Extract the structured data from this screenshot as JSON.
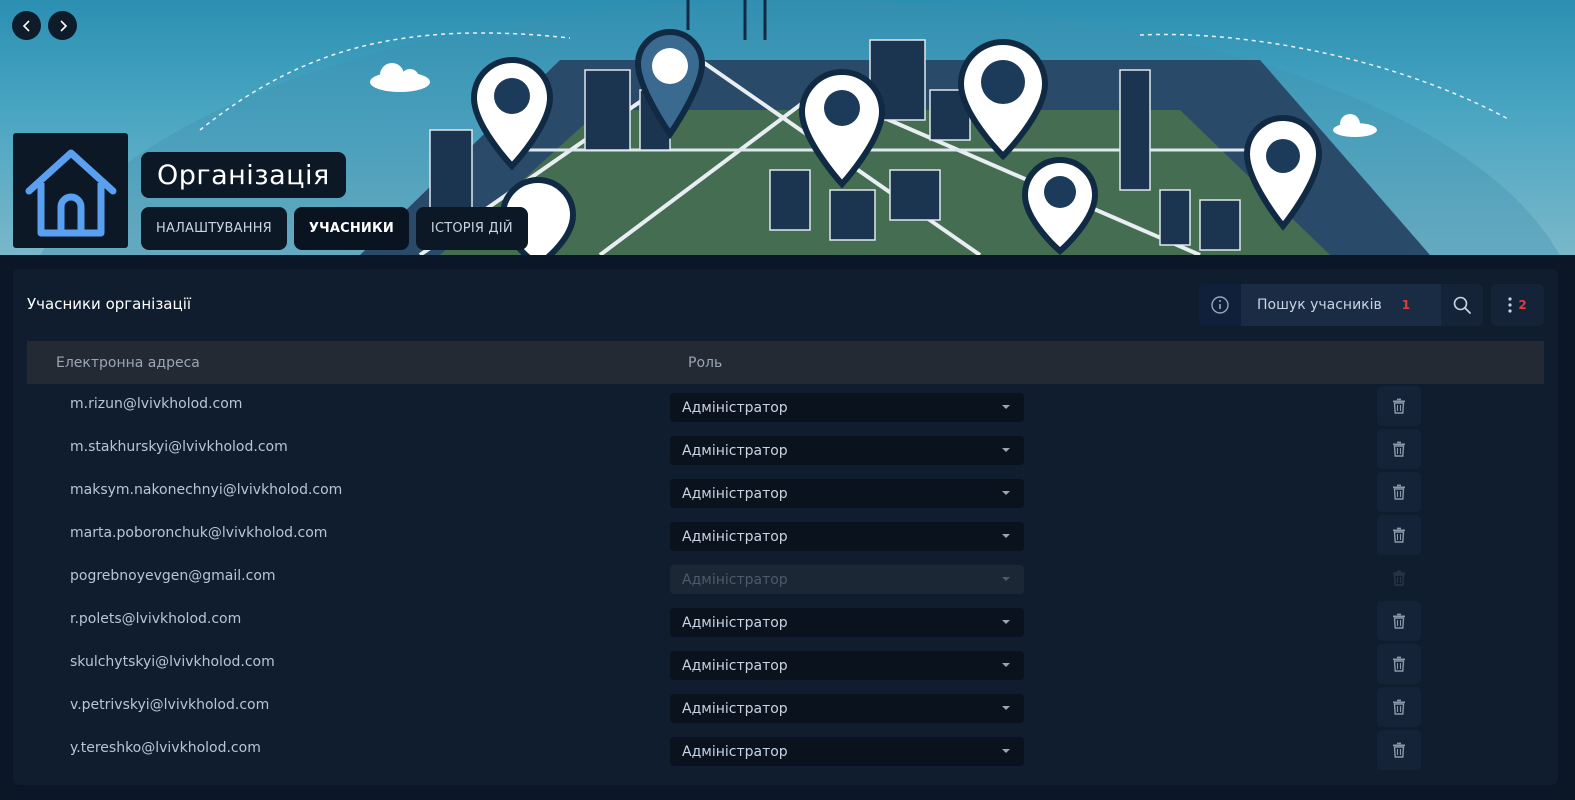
{
  "header": {
    "title": "Організація",
    "tabs": [
      {
        "label": "НАЛАШТУВАННЯ",
        "active": false
      },
      {
        "label": "УЧАСНИКИ",
        "active": true
      },
      {
        "label": "ІСТОРІЯ ДІЙ",
        "active": false
      }
    ],
    "icons": {
      "back": "chevron-left-icon",
      "forward": "chevron-right-icon",
      "org": "house-icon"
    }
  },
  "members": {
    "title": "Учасники організації",
    "search": {
      "placeholder": "Пошук учасників",
      "badge": "1"
    },
    "menu_badge": "2",
    "columns": {
      "email": "Електронна адреса",
      "role": "Роль"
    },
    "rows": [
      {
        "email": "m.rizun@lvivkholod.com",
        "role": "Адміністратор",
        "disabled": false
      },
      {
        "email": "m.stakhurskyi@lvivkholod.com",
        "role": "Адміністратор",
        "disabled": false
      },
      {
        "email": "maksym.nakonechnyi@lvivkholod.com",
        "role": "Адміністратор",
        "disabled": false
      },
      {
        "email": "marta.poboronchuk@lvivkholod.com",
        "role": "Адміністратор",
        "disabled": false
      },
      {
        "email": "pogrebnoyevgen@gmail.com",
        "role": "Адміністратор",
        "disabled": true
      },
      {
        "email": "r.polets@lvivkholod.com",
        "role": "Адміністратор",
        "disabled": false
      },
      {
        "email": "skulchytskyi@lvivkholod.com",
        "role": "Адміністратор",
        "disabled": false
      },
      {
        "email": "v.petrivskyi@lvivkholod.com",
        "role": "Адміністратор",
        "disabled": false
      },
      {
        "email": "y.tereshko@lvivkholod.com",
        "role": "Адміністратор",
        "disabled": false
      }
    ]
  },
  "colors": {
    "accent": "#5aa0f0",
    "badge": "#e23b3b",
    "background": "#0b1626",
    "card": "#0f1d2e"
  }
}
